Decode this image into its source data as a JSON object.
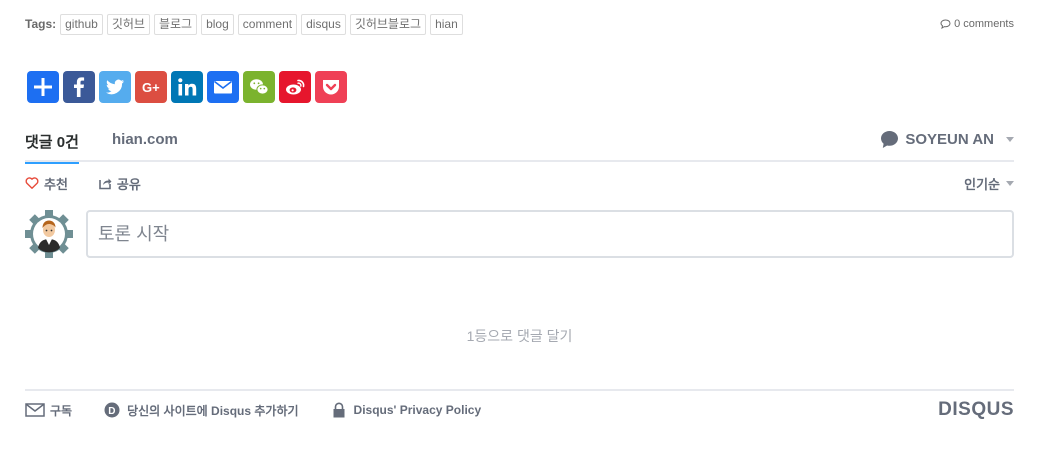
{
  "tags": {
    "label": "Tags:",
    "items": [
      "github",
      "깃허브",
      "블로그",
      "blog",
      "comment",
      "disqus",
      "깃허브블로그",
      "hian"
    ]
  },
  "comments_link": "0 comments",
  "share": [
    {
      "name": "add-share-icon",
      "color": "#1d6ff2"
    },
    {
      "name": "facebook-icon",
      "color": "#3b5998"
    },
    {
      "name": "twitter-icon",
      "color": "#55acee"
    },
    {
      "name": "google-plus-icon",
      "color": "#dc4e41"
    },
    {
      "name": "linkedin-icon",
      "color": "#0077b5"
    },
    {
      "name": "email-icon",
      "color": "#1d6ff2"
    },
    {
      "name": "wechat-icon",
      "color": "#7bb32e"
    },
    {
      "name": "weibo-icon",
      "color": "#e6162d"
    },
    {
      "name": "pocket-icon",
      "color": "#ef4056"
    }
  ],
  "disqus": {
    "tab_count": "댓글 0건",
    "tab_site": "hian.com",
    "user_name": "SOYEUN AN",
    "recommend": "추천",
    "share": "공유",
    "sort": "인기순",
    "composer_placeholder": "토론 시작",
    "empty": "1등으로 댓글 달기",
    "footer": {
      "subscribe": "구독",
      "add_disqus": "당신의 사이트에 Disqus 추가하기",
      "privacy": "Disqus' Privacy Policy",
      "brand": "DISQUS"
    },
    "accent_color": "#2e9fff"
  }
}
